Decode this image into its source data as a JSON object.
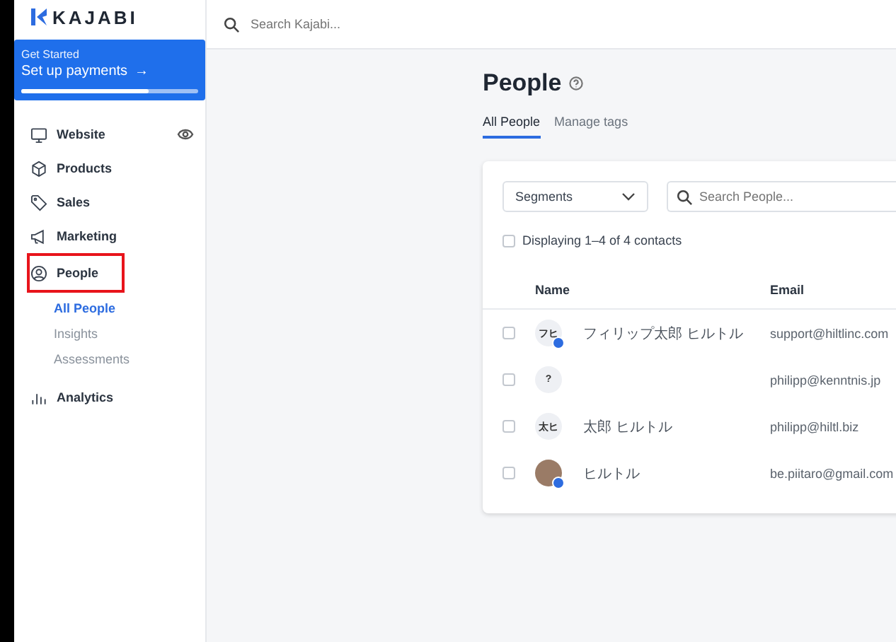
{
  "brand": {
    "name": "KAJABI"
  },
  "search": {
    "placeholder": "Search Kajabi..."
  },
  "banner": {
    "kicker": "Get Started",
    "title": "Set up payments",
    "arrow": "→",
    "level": 0.72
  },
  "sidebar": {
    "items": [
      {
        "label": "Website",
        "highlighted": false,
        "eye": true
      },
      {
        "label": "Products",
        "highlighted": false,
        "eye": false
      },
      {
        "label": "Sales",
        "highlighted": false,
        "eye": false
      },
      {
        "label": "Marketing",
        "highlighted": false,
        "eye": false
      },
      {
        "label": "People",
        "highlighted": true,
        "eye": false,
        "children": [
          {
            "label": "All People",
            "selected": true
          },
          {
            "label": "Insights",
            "selected": false
          },
          {
            "label": "Assessments",
            "selected": false
          }
        ]
      },
      {
        "label": "Analytics",
        "highlighted": false,
        "eye": false
      }
    ]
  },
  "page": {
    "title": "People"
  },
  "tabs": [
    {
      "label": "All People",
      "selected": true
    },
    {
      "label": "Manage tags",
      "selected": false
    }
  ],
  "segments": {
    "value": "Segments"
  },
  "people_search": {
    "placeholder": "Search People..."
  },
  "select_all": {
    "label": "Displaying 1–4 of 4 contacts",
    "checked": false
  },
  "table": {
    "columns": [
      "Name",
      "Email"
    ],
    "rows": [
      {
        "kind": "initials",
        "avatar": "フヒ",
        "verified": true,
        "name": "フィリップ太郎 ヒルトル",
        "email": "support@hiltlinc.com",
        "checked": false
      },
      {
        "kind": "initials",
        "avatar": "?",
        "verified": false,
        "email": "philipp@kenntnis.jp",
        "checked": false
      },
      {
        "kind": "initials",
        "avatar": "太ヒ",
        "verified": false,
        "name": "太郎 ヒルトル",
        "email": "philipp@hiltl.biz",
        "checked": false
      },
      {
        "kind": "photo",
        "verified": true,
        "name": "ヒルトル",
        "email": "be.piitaro@gmail.com",
        "checked": false
      }
    ]
  }
}
